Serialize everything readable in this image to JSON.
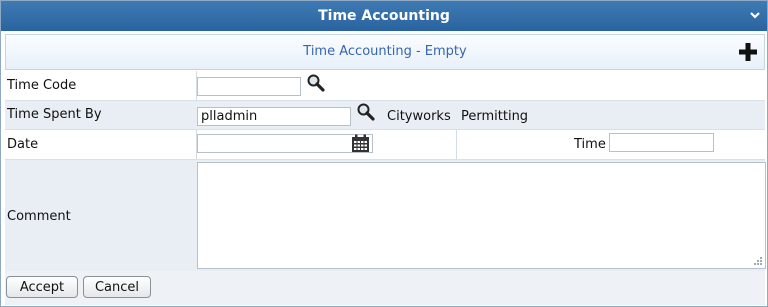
{
  "window": {
    "title": "Time Accounting",
    "collapse_icon": "chevron-down-icon"
  },
  "section": {
    "header": "Time Accounting - Empty",
    "add_icon": "plus-icon"
  },
  "form": {
    "time_code": {
      "label": "Time Code",
      "value": "",
      "lookup_icon": "search-icon"
    },
    "time_spent_by": {
      "label": "Time Spent By",
      "value": "plladmin",
      "lookup_icon": "search-icon",
      "org": "Cityworks",
      "dept": "Permitting"
    },
    "date": {
      "label": "Date",
      "value": "",
      "calendar_icon": "calendar-icon"
    },
    "time": {
      "label": "Time",
      "value": ""
    },
    "comment": {
      "label": "Comment",
      "value": ""
    }
  },
  "actions": {
    "accept_label": "Accept",
    "cancel_label": "Cancel"
  },
  "colors": {
    "titlebar": "#2f6ca8",
    "header_text": "#3765b0",
    "row_shade": "#e9eef4"
  }
}
